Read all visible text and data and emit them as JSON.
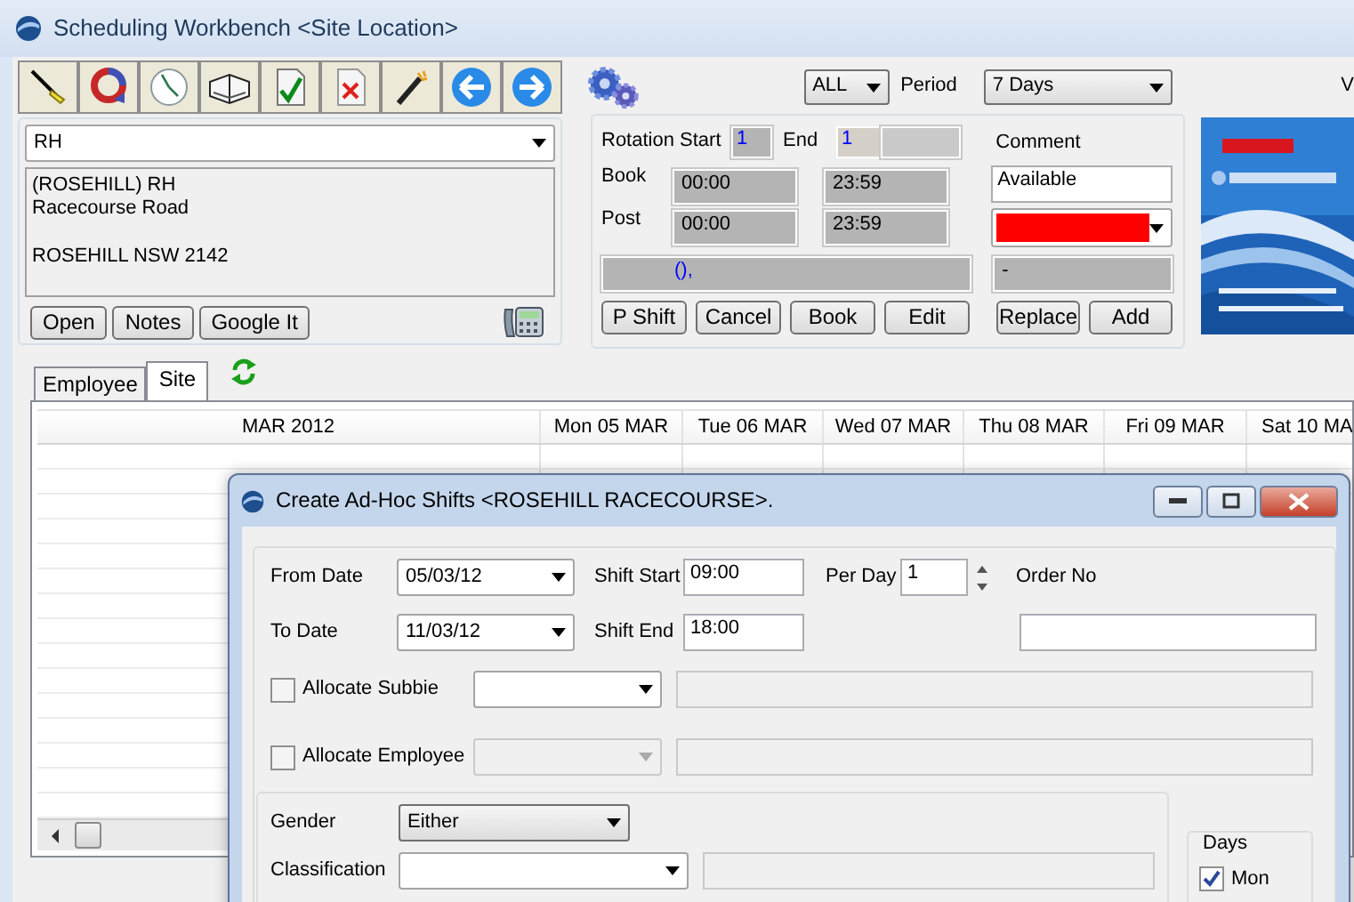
{
  "window": {
    "title": "Scheduling Workbench <Site Location>"
  },
  "filter": {
    "scope": "ALL",
    "period_label": "Period",
    "period": "7 Days",
    "edge_label": "V"
  },
  "site": {
    "code": "RH",
    "address_lines": [
      "(ROSEHILL) RH",
      "Racecourse Road"
    ],
    "locality": "ROSEHILL NSW 2142",
    "buttons": [
      "Open",
      "Notes",
      "Google It"
    ]
  },
  "rotation": {
    "start_label": "Rotation Start",
    "start": "1",
    "end_label": "End",
    "end": "1",
    "book_label": "Book",
    "book_from": "00:00",
    "book_to": "23:59",
    "post_label": "Post",
    "post_from": "00:00",
    "post_to": "23:59",
    "summary": "(),",
    "comment_label": "Comment",
    "comment": "Available",
    "color": "#ff0000",
    "status": "-",
    "buttons": [
      "P Shift",
      "Cancel",
      "Book",
      "Edit",
      "Replace",
      "Add"
    ]
  },
  "tabs": [
    {
      "label": "Employee",
      "selected": false
    },
    {
      "label": "Site",
      "selected": true
    }
  ],
  "schedule": {
    "columns": [
      "MAR 2012",
      "Mon 05 MAR",
      "Tue 06 MAR",
      "Wed 07 MAR",
      "Thu 08 MAR",
      "Fri 09 MAR",
      "Sat 10 MA"
    ]
  },
  "dialog": {
    "title": "Create Ad-Hoc Shifts <ROSEHILL RACECOURSE>.",
    "from_date_label": "From Date",
    "from_date": "05/03/12",
    "to_date_label": "To Date",
    "to_date": "11/03/12",
    "shift_start_label": "Shift Start",
    "shift_start": "09:00",
    "shift_end_label": "Shift End",
    "shift_end": "18:00",
    "per_day_label": "Per Day",
    "per_day": "1",
    "order_no_label": "Order No",
    "allocations": [
      {
        "label": "Allocate Subbie",
        "checked": false,
        "disabled": false
      },
      {
        "label": "Allocate Employee",
        "checked": false,
        "disabled": true
      }
    ],
    "gender_label": "Gender",
    "gender": "Either",
    "classification_label": "Classification",
    "days": {
      "title": "Days",
      "items": [
        {
          "label": "Mon",
          "checked": true
        }
      ]
    }
  }
}
